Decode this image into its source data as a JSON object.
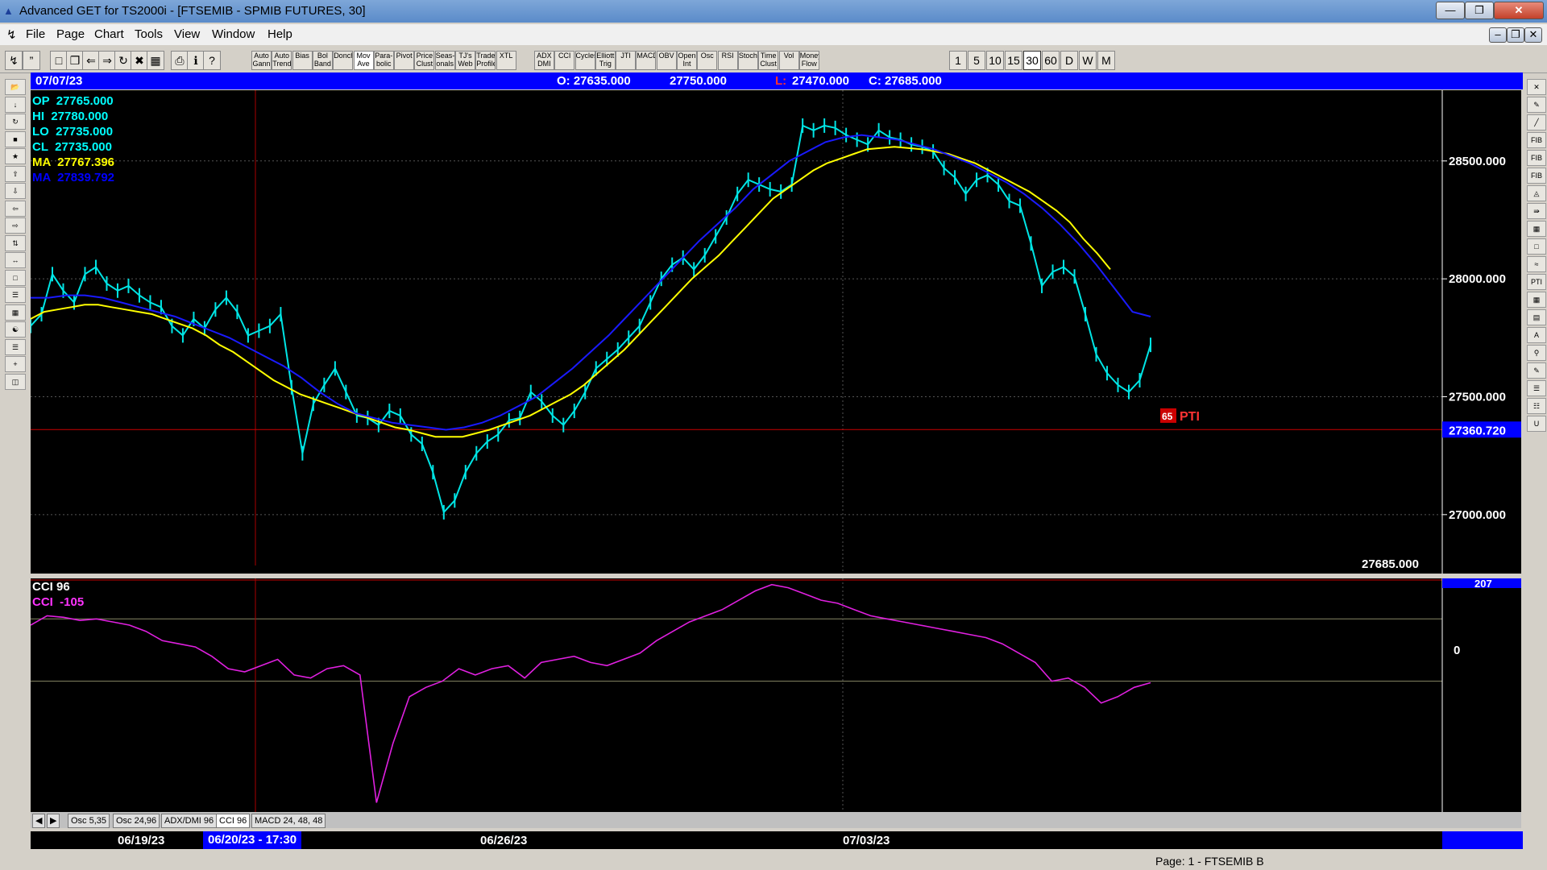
{
  "window": {
    "title": "Advanced GET for TS2000i - [FTSEMIB - SPMIB FUTURES, 30]"
  },
  "menu": [
    "File",
    "Page",
    "Chart",
    "Tools",
    "View",
    "Window",
    "Help"
  ],
  "toolbar": {
    "indicator_buttons": [
      "Auto Gann",
      "Auto Trend",
      "Bias",
      "Bol Band",
      "Donch",
      "Mov Ave",
      "Para-bolic",
      "Pivot",
      "Price Clust",
      "Seas-onals",
      "TJ's Web",
      "Trade Profile",
      "XTL",
      "ADX DMI",
      "CCI",
      "Cycles",
      "Elliott Trig",
      "JTI",
      "MACD",
      "OBV",
      "Open Int",
      "Osc",
      "RSI",
      "Stoch",
      "Time Clust",
      "Vol",
      "Money Flow"
    ],
    "timeframes": [
      "1",
      "5",
      "10",
      "15",
      "30",
      "60",
      "D",
      "W",
      "M"
    ],
    "active_timeframe": "30"
  },
  "info_bar": {
    "date": "07/07/23",
    "open": "O: 27635.000",
    "high": "27750.000",
    "low_label": "L:",
    "low": "27470.000",
    "close": "C: 27685.000"
  },
  "readout": [
    {
      "label": "OP",
      "value": "27765.000",
      "color": "#00ffff"
    },
    {
      "label": "HI",
      "value": "27780.000",
      "color": "#00ffff"
    },
    {
      "label": "LO",
      "value": "27735.000",
      "color": "#00ffff"
    },
    {
      "label": "CL",
      "value": "27735.000",
      "color": "#00ffff"
    },
    {
      "label": "MA",
      "value": "27767.396",
      "color": "#ffff00"
    },
    {
      "label": "MA",
      "value": "27839.792",
      "color": "#0000ff"
    }
  ],
  "price_axis": {
    "ticks": [
      "28500.000",
      "28000.000",
      "27500.000",
      "27000.000"
    ],
    "tick_values": [
      28500,
      28000,
      27500,
      27000
    ],
    "highlight_label": "27360.720",
    "highlight_value": 27360.72,
    "last_price_label": "27685.000"
  },
  "pti": {
    "value": "65",
    "label": "PTI"
  },
  "cci_panel": {
    "title": "CCI 96",
    "reading": "CCI  -105",
    "axis_top_label": "207",
    "axis_zero_label": "0"
  },
  "date_axis": {
    "labels": [
      "06/19/23",
      "06/20/23 - 17:30",
      "06/26/23",
      "07/03/23"
    ]
  },
  "tabs": [
    "Osc 5,35",
    "Osc 24,96",
    "ADX/DMI 96",
    "CCI 96",
    "MACD 24, 48, 48"
  ],
  "active_tab": "CCI 96",
  "status": {
    "page": "Page: 1 - FTSEMIB B"
  },
  "chart_data": {
    "type": "line",
    "title": "FTSEMIB - SPMIB FUTURES, 30",
    "xlabel": "",
    "ylabel": "",
    "ylim": [
      26750,
      28800
    ],
    "series": [
      {
        "values": [
          27800,
          27850,
          28020,
          27950,
          27900,
          28020,
          28050,
          27980,
          27950,
          27970,
          27930,
          27900,
          27880,
          27800,
          27760,
          27830,
          27790,
          27870,
          27920,
          27860,
          27760,
          27780,
          27800,
          27850,
          27540,
          27260,
          27470,
          27550,
          27620,
          27520,
          27420,
          27410,
          27380,
          27440,
          27420,
          27340,
          27300,
          27180,
          27010,
          27060,
          27180,
          27260,
          27310,
          27340,
          27400,
          27410,
          27520,
          27480,
          27420,
          27380,
          27440,
          27520,
          27620,
          27660,
          27700,
          27750,
          27800,
          27900,
          28000,
          28060,
          28090,
          28040,
          28100,
          28180,
          28260,
          28360,
          28420,
          28400,
          28380,
          28370,
          28400,
          28650,
          28630,
          28650,
          28640,
          28610,
          28590,
          28570,
          28630,
          28600,
          28590,
          28570,
          28560,
          28540,
          28470,
          28430,
          28360,
          28420,
          28440,
          28400,
          28330,
          28310,
          28150,
          27970,
          28030,
          28050,
          28010,
          27850,
          27680,
          27600,
          27550,
          27520,
          27570,
          27720
        ]
      },
      {
        "values": [
          27830,
          27860,
          27870,
          27880,
          27890,
          27890,
          27880,
          27870,
          27860,
          27850,
          27830,
          27810,
          27790,
          27760,
          27720,
          27690,
          27650,
          27610,
          27570,
          27540,
          27510,
          27490,
          27470,
          27450,
          27430,
          27410,
          27390,
          27370,
          27360,
          27345,
          27330,
          27330,
          27330,
          27345,
          27360,
          27380,
          27400,
          27420,
          27450,
          27480,
          27510,
          27550,
          27600,
          27650,
          27700,
          27760,
          27820,
          27880,
          27940,
          28000,
          28050,
          28100,
          28160,
          28220,
          28280,
          28340,
          28380,
          28420,
          28460,
          28490,
          28510,
          28530,
          28550,
          28555,
          28560,
          28555,
          28550,
          28540,
          28530,
          28510,
          28490,
          28460,
          28430,
          28400,
          28370,
          28330,
          28290,
          28240,
          28170,
          28110,
          28040
        ]
      },
      {
        "values": [
          27920,
          27920,
          27930,
          27930,
          27920,
          27900,
          27880,
          27860,
          27840,
          27810,
          27780,
          27750,
          27710,
          27670,
          27630,
          27580,
          27520,
          27470,
          27430,
          27410,
          27390,
          27380,
          27370,
          27360,
          27370,
          27390,
          27420,
          27460,
          27500,
          27560,
          27620,
          27690,
          27760,
          27840,
          27920,
          28000,
          28080,
          28160,
          28230,
          28300,
          28380,
          28440,
          28500,
          28540,
          28580,
          28600,
          28610,
          28600,
          28590,
          28570,
          28550,
          28520,
          28490,
          28450,
          28410,
          28360,
          28300,
          28230,
          28150,
          28060,
          27960,
          27860,
          27840
        ]
      },
      {
        "name": "CCI 96",
        "values": [
          80,
          110,
          105,
          95,
          100,
          90,
          80,
          60,
          30,
          20,
          10,
          -20,
          -60,
          -70,
          -50,
          -30,
          -80,
          -90,
          -60,
          -50,
          -80,
          -490,
          -300,
          -150,
          -120,
          -100,
          -60,
          -80,
          -60,
          -50,
          -90,
          -40,
          -30,
          -20,
          -40,
          -50,
          -30,
          -10,
          30,
          60,
          90,
          110,
          130,
          160,
          190,
          210,
          200,
          180,
          160,
          150,
          130,
          110,
          100,
          90,
          80,
          70,
          60,
          50,
          40,
          20,
          -10,
          -40,
          -100,
          -90,
          -120,
          -170,
          -150,
          -120,
          -105
        ]
      }
    ]
  }
}
